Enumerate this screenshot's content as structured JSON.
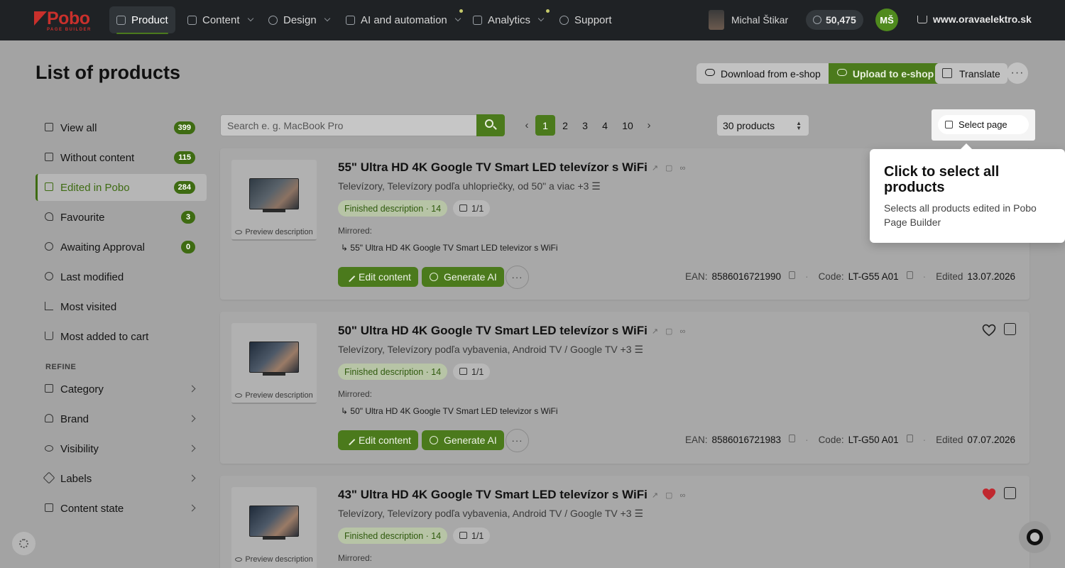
{
  "nav": {
    "logo_text": "Pobo",
    "logo_sub": "PAGE BUILDER",
    "items": [
      {
        "label": "Product"
      },
      {
        "label": "Content"
      },
      {
        "label": "Design"
      },
      {
        "label": "AI and automation"
      },
      {
        "label": "Analytics"
      },
      {
        "label": "Support"
      }
    ],
    "user_name": "Michal Štikar",
    "credits": "50,475",
    "avatar_initials": "MŠ",
    "shop_url": "www.oravaelektro.sk"
  },
  "header": {
    "title": "List of products",
    "download_label": "Download from e-shop",
    "upload_label": "Upload to e-shop",
    "translate_label": "Translate",
    "more_label": "···"
  },
  "sidebar": {
    "items": [
      {
        "label": "View all",
        "count": "399",
        "icon": "list-icon"
      },
      {
        "label": "Without content",
        "count": "115",
        "icon": "grid-icon"
      },
      {
        "label": "Edited in Pobo",
        "count": "284",
        "icon": "grid-filled-icon"
      },
      {
        "label": "Favourite",
        "count": "3",
        "icon": "heart-icon"
      },
      {
        "label": "Awaiting Approval",
        "count": "0",
        "icon": "clock-icon"
      },
      {
        "label": "Last modified",
        "icon": "clock-icon"
      },
      {
        "label": "Most visited",
        "icon": "chart-icon"
      },
      {
        "label": "Most added to cart",
        "icon": "cart-icon"
      }
    ],
    "refine_heading": "REFINE",
    "refine_items": [
      {
        "label": "Category",
        "icon": "folder-icon"
      },
      {
        "label": "Brand",
        "icon": "brand-icon"
      },
      {
        "label": "Visibility",
        "icon": "eye-icon"
      },
      {
        "label": "Labels",
        "icon": "tag-icon"
      },
      {
        "label": "Content state",
        "icon": "content-state-icon"
      }
    ]
  },
  "toolbar": {
    "search_placeholder": "Search e. g. MacBook Pro",
    "pagination": {
      "prev": "‹",
      "next": "›",
      "pages": [
        "1",
        "2",
        "3",
        "4",
        "10"
      ],
      "current": "1"
    },
    "per_page": "30 products",
    "select_page_label": "Select page"
  },
  "tooltip": {
    "title": "Click to select all products",
    "body": "Selects all products edited in Pobo Page Builder"
  },
  "products": [
    {
      "title": "55\" Ultra HD 4K Google TV Smart LED televízor s WiFi",
      "categories": "Televízory, Televízory podľa uhlopriečky, od 50\" a viac",
      "more_categories": "+3",
      "desc_badge": "Finished description · 14",
      "lang_badge": "1/1",
      "preview_label": "Preview description",
      "mirrored_label": "Mirrored:",
      "mirrored_item": "55\" Ultra HD 4K Google TV Smart LED televizor s WiFi",
      "edit_label": "Edit content",
      "generate_label": "Generate AI",
      "ean_label": "EAN:",
      "ean": "8586016721990",
      "code_label": "Code:",
      "code": "LT-G55 A01",
      "edited_label": "Edited",
      "edited": "13.07.2026",
      "favourite": false
    },
    {
      "title": "50\" Ultra HD 4K Google TV Smart LED televízor s WiFi",
      "categories": "Televízory, Televízory podľa vybavenia, Android TV / Google TV",
      "more_categories": "+3",
      "desc_badge": "Finished description · 14",
      "lang_badge": "1/1",
      "preview_label": "Preview description",
      "mirrored_label": "Mirrored:",
      "mirrored_item": "50\" Ultra HD 4K Google TV Smart LED televizor s WiFi",
      "edit_label": "Edit content",
      "generate_label": "Generate AI",
      "ean_label": "EAN:",
      "ean": "8586016721983",
      "code_label": "Code:",
      "code": "LT-G50 A01",
      "edited_label": "Edited",
      "edited": "07.07.2026",
      "favourite": false
    },
    {
      "title": "43\" Ultra HD 4K Google TV Smart LED televízor s WiFi",
      "categories": "Televízory, Televízory podľa vybavenia, Android TV / Google TV",
      "more_categories": "+3",
      "desc_badge": "Finished description · 14",
      "lang_badge": "1/1",
      "preview_label": "Preview description",
      "mirrored_label": "Mirrored:",
      "favourite": true
    }
  ],
  "colors": {
    "accent": "#4b7a1c",
    "nav_bg": "#1f2225",
    "favourite_red": "#c0282f"
  }
}
